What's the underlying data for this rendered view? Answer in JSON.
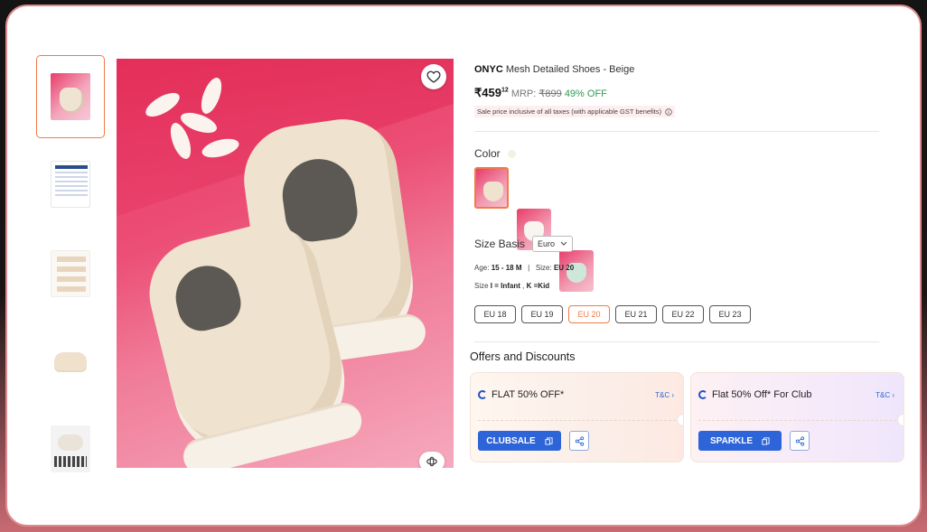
{
  "product": {
    "brand": "ONYC",
    "name": "Mesh Detailed Shoes - Beige",
    "price": "₹459",
    "price_paise": "12",
    "mrp_label": "MRP:",
    "mrp_value": "₹899",
    "discount": "49% OFF",
    "tax_note": "Sale price inclusive of all taxes (with applicable GST benefits)"
  },
  "color": {
    "label": "Color",
    "swatches": [
      "Beige",
      "White",
      "Mint"
    ]
  },
  "size": {
    "basis_label": "Size Basis",
    "basis_selected": "Euro",
    "age_label": "Age:",
    "age_value": "15 - 18 M",
    "separator": "|",
    "size_label": "Size:",
    "size_value": "EU 20",
    "note_prefix": "Size",
    "note_i": "I = Infant",
    "note_sep": ",",
    "note_k": "K =Kid",
    "options": [
      "EU 18",
      "EU 19",
      "EU 20",
      "EU 21",
      "EU 22",
      "EU 23"
    ],
    "selected": "EU 20"
  },
  "offers": {
    "title": "Offers and Discounts",
    "cards": [
      {
        "headline": "FLAT 50% OFF*",
        "tnc": "T&C",
        "code": "CLUBSALE"
      },
      {
        "headline": "Flat 50% Off* For Club",
        "tnc": "T&C",
        "code": "SPARKLE"
      }
    ]
  },
  "colors": {
    "accent": "#f07b45",
    "primary_button": "#2d64d8",
    "discount_green": "#2e9b4e"
  }
}
